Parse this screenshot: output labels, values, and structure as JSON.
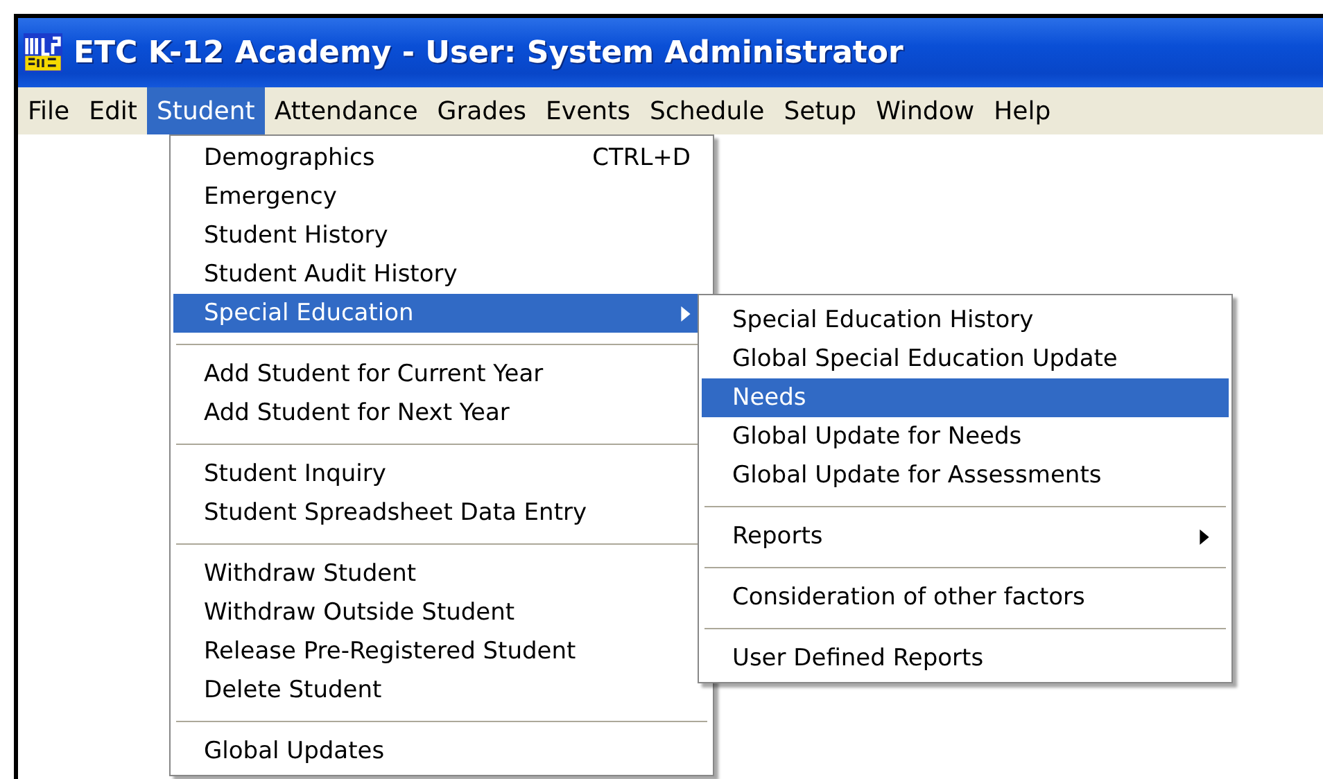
{
  "window": {
    "title": "ETC K-12 Academy - User: System Administrator"
  },
  "menu_bar": [
    {
      "label": "File",
      "selected": false
    },
    {
      "label": "Edit",
      "selected": false
    },
    {
      "label": "Student",
      "selected": true
    },
    {
      "label": "Attendance",
      "selected": false
    },
    {
      "label": "Grades",
      "selected": false
    },
    {
      "label": "Events",
      "selected": false
    },
    {
      "label": "Schedule",
      "selected": false
    },
    {
      "label": "Setup",
      "selected": false
    },
    {
      "label": "Window",
      "selected": false
    },
    {
      "label": "Help",
      "selected": false
    }
  ],
  "student_menu": [
    {
      "kind": "item",
      "label": "Demographics",
      "shortcut": "CTRL+D",
      "selected": false
    },
    {
      "kind": "item",
      "label": "Emergency",
      "selected": false
    },
    {
      "kind": "item",
      "label": "Student History",
      "selected": false
    },
    {
      "kind": "item",
      "label": "Student Audit History",
      "selected": false
    },
    {
      "kind": "submenu",
      "label": "Special Education",
      "selected": true
    },
    {
      "kind": "separator"
    },
    {
      "kind": "item",
      "label": "Add Student for Current Year",
      "selected": false
    },
    {
      "kind": "item",
      "label": "Add Student for Next Year",
      "selected": false
    },
    {
      "kind": "separator"
    },
    {
      "kind": "item",
      "label": "Student Inquiry",
      "selected": false
    },
    {
      "kind": "item",
      "label": "Student Spreadsheet Data Entry",
      "selected": false
    },
    {
      "kind": "separator"
    },
    {
      "kind": "item",
      "label": "Withdraw Student",
      "selected": false
    },
    {
      "kind": "item",
      "label": "Withdraw Outside Student",
      "selected": false
    },
    {
      "kind": "item",
      "label": "Release Pre-Registered Student",
      "selected": false
    },
    {
      "kind": "item",
      "label": "Delete Student",
      "selected": false
    },
    {
      "kind": "separator"
    },
    {
      "kind": "item",
      "label": "Global Updates",
      "selected": false
    }
  ],
  "special_education_menu": [
    {
      "kind": "item",
      "label": "Special Education History",
      "selected": false
    },
    {
      "kind": "item",
      "label": "Global Special Education Update",
      "selected": false
    },
    {
      "kind": "item",
      "label": "Needs",
      "selected": true
    },
    {
      "kind": "item",
      "label": "Global Update for Needs",
      "selected": false
    },
    {
      "kind": "item",
      "label": "Global Update for  Assessments",
      "selected": false
    },
    {
      "kind": "separator"
    },
    {
      "kind": "submenu",
      "label": "Reports",
      "selected": false
    },
    {
      "kind": "separator"
    },
    {
      "kind": "item",
      "label": "Consideration of other factors",
      "selected": false
    },
    {
      "kind": "separator"
    },
    {
      "kind": "item",
      "label": "User Defined Reports",
      "selected": false
    }
  ]
}
